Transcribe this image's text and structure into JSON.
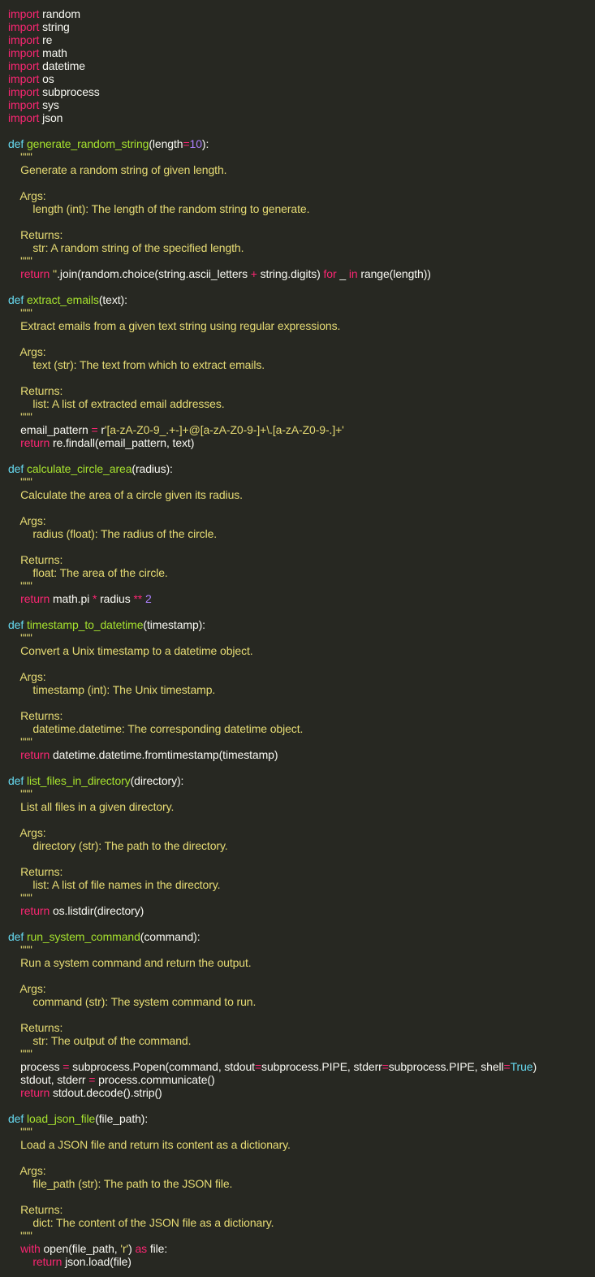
{
  "theme": {
    "background": "#272822",
    "keyword": "#f92672",
    "function_name": "#a6e22e",
    "def_keyword": "#66d9ef",
    "string": "#e6db74",
    "number": "#ae81ff",
    "plain": "#f8f8f2"
  },
  "lines": [
    [
      {
        "t": "kw",
        "v": "import"
      },
      {
        "t": "plain",
        "v": " random"
      }
    ],
    [
      {
        "t": "kw",
        "v": "import"
      },
      {
        "t": "plain",
        "v": " string"
      }
    ],
    [
      {
        "t": "kw",
        "v": "import"
      },
      {
        "t": "plain",
        "v": " re"
      }
    ],
    [
      {
        "t": "kw",
        "v": "import"
      },
      {
        "t": "plain",
        "v": " math"
      }
    ],
    [
      {
        "t": "kw",
        "v": "import"
      },
      {
        "t": "plain",
        "v": " datetime"
      }
    ],
    [
      {
        "t": "kw",
        "v": "import"
      },
      {
        "t": "plain",
        "v": " os"
      }
    ],
    [
      {
        "t": "kw",
        "v": "import"
      },
      {
        "t": "plain",
        "v": " subprocess"
      }
    ],
    [
      {
        "t": "kw",
        "v": "import"
      },
      {
        "t": "plain",
        "v": " sys"
      }
    ],
    [
      {
        "t": "kw",
        "v": "import"
      },
      {
        "t": "plain",
        "v": " json"
      }
    ],
    [],
    [
      {
        "t": "def",
        "v": "def"
      },
      {
        "t": "plain",
        "v": " "
      },
      {
        "t": "fn",
        "v": "generate_random_string"
      },
      {
        "t": "plain",
        "v": "(length"
      },
      {
        "t": "op",
        "v": "="
      },
      {
        "t": "num",
        "v": "10"
      },
      {
        "t": "plain",
        "v": "):"
      }
    ],
    [
      {
        "t": "doc",
        "v": "    \"\"\""
      }
    ],
    [
      {
        "t": "doc",
        "v": "    Generate a random string of given length."
      }
    ],
    [],
    [
      {
        "t": "doc",
        "v": "    Args:"
      }
    ],
    [
      {
        "t": "doc",
        "v": "        length (int): The length of the random string to generate."
      }
    ],
    [],
    [
      {
        "t": "doc",
        "v": "    Returns:"
      }
    ],
    [
      {
        "t": "doc",
        "v": "        str: A random string of the specified length."
      }
    ],
    [
      {
        "t": "doc",
        "v": "    \"\"\""
      }
    ],
    [
      {
        "t": "plain",
        "v": "    "
      },
      {
        "t": "kw",
        "v": "return"
      },
      {
        "t": "plain",
        "v": " "
      },
      {
        "t": "str",
        "v": "''"
      },
      {
        "t": "plain",
        "v": ".join(random.choice(string.ascii_letters "
      },
      {
        "t": "op",
        "v": "+"
      },
      {
        "t": "plain",
        "v": " string.digits) "
      },
      {
        "t": "kw",
        "v": "for"
      },
      {
        "t": "plain",
        "v": " _ "
      },
      {
        "t": "kw",
        "v": "in"
      },
      {
        "t": "plain",
        "v": " range(length))"
      }
    ],
    [],
    [
      {
        "t": "def",
        "v": "def"
      },
      {
        "t": "plain",
        "v": " "
      },
      {
        "t": "fn",
        "v": "extract_emails"
      },
      {
        "t": "plain",
        "v": "(text):"
      }
    ],
    [
      {
        "t": "doc",
        "v": "    \"\"\""
      }
    ],
    [
      {
        "t": "doc",
        "v": "    Extract emails from a given text string using regular expressions."
      }
    ],
    [],
    [
      {
        "t": "doc",
        "v": "    Args:"
      }
    ],
    [
      {
        "t": "doc",
        "v": "        text (str): The text from which to extract emails."
      }
    ],
    [],
    [
      {
        "t": "doc",
        "v": "    Returns:"
      }
    ],
    [
      {
        "t": "doc",
        "v": "        list: A list of extracted email addresses."
      }
    ],
    [
      {
        "t": "doc",
        "v": "    \"\"\""
      }
    ],
    [
      {
        "t": "plain",
        "v": "    email_pattern "
      },
      {
        "t": "op",
        "v": "="
      },
      {
        "t": "plain",
        "v": " r"
      },
      {
        "t": "str",
        "v": "'[a-zA-Z0-9_.+-]+@[a-zA-Z0-9-]+\\.[a-zA-Z0-9-.]+'"
      }
    ],
    [
      {
        "t": "plain",
        "v": "    "
      },
      {
        "t": "kw",
        "v": "return"
      },
      {
        "t": "plain",
        "v": " re.findall(email_pattern, text)"
      }
    ],
    [],
    [
      {
        "t": "def",
        "v": "def"
      },
      {
        "t": "plain",
        "v": " "
      },
      {
        "t": "fn",
        "v": "calculate_circle_area"
      },
      {
        "t": "plain",
        "v": "(radius):"
      }
    ],
    [
      {
        "t": "doc",
        "v": "    \"\"\""
      }
    ],
    [
      {
        "t": "doc",
        "v": "    Calculate the area of a circle given its radius."
      }
    ],
    [],
    [
      {
        "t": "doc",
        "v": "    Args:"
      }
    ],
    [
      {
        "t": "doc",
        "v": "        radius (float): The radius of the circle."
      }
    ],
    [],
    [
      {
        "t": "doc",
        "v": "    Returns:"
      }
    ],
    [
      {
        "t": "doc",
        "v": "        float: The area of the circle."
      }
    ],
    [
      {
        "t": "doc",
        "v": "    \"\"\""
      }
    ],
    [
      {
        "t": "plain",
        "v": "    "
      },
      {
        "t": "kw",
        "v": "return"
      },
      {
        "t": "plain",
        "v": " math.pi "
      },
      {
        "t": "op",
        "v": "*"
      },
      {
        "t": "plain",
        "v": " radius "
      },
      {
        "t": "op",
        "v": "**"
      },
      {
        "t": "plain",
        "v": " "
      },
      {
        "t": "num",
        "v": "2"
      }
    ],
    [],
    [
      {
        "t": "def",
        "v": "def"
      },
      {
        "t": "plain",
        "v": " "
      },
      {
        "t": "fn",
        "v": "timestamp_to_datetime"
      },
      {
        "t": "plain",
        "v": "(timestamp):"
      }
    ],
    [
      {
        "t": "doc",
        "v": "    \"\"\""
      }
    ],
    [
      {
        "t": "doc",
        "v": "    Convert a Unix timestamp to a datetime object."
      }
    ],
    [],
    [
      {
        "t": "doc",
        "v": "    Args:"
      }
    ],
    [
      {
        "t": "doc",
        "v": "        timestamp (int): The Unix timestamp."
      }
    ],
    [],
    [
      {
        "t": "doc",
        "v": "    Returns:"
      }
    ],
    [
      {
        "t": "doc",
        "v": "        datetime.datetime: The corresponding datetime object."
      }
    ],
    [
      {
        "t": "doc",
        "v": "    \"\"\""
      }
    ],
    [
      {
        "t": "plain",
        "v": "    "
      },
      {
        "t": "kw",
        "v": "return"
      },
      {
        "t": "plain",
        "v": " datetime.datetime.fromtimestamp(timestamp)"
      }
    ],
    [],
    [
      {
        "t": "def",
        "v": "def"
      },
      {
        "t": "plain",
        "v": " "
      },
      {
        "t": "fn",
        "v": "list_files_in_directory"
      },
      {
        "t": "plain",
        "v": "(directory):"
      }
    ],
    [
      {
        "t": "doc",
        "v": "    \"\"\""
      }
    ],
    [
      {
        "t": "doc",
        "v": "    List all files in a given directory."
      }
    ],
    [],
    [
      {
        "t": "doc",
        "v": "    Args:"
      }
    ],
    [
      {
        "t": "doc",
        "v": "        directory (str): The path to the directory."
      }
    ],
    [],
    [
      {
        "t": "doc",
        "v": "    Returns:"
      }
    ],
    [
      {
        "t": "doc",
        "v": "        list: A list of file names in the directory."
      }
    ],
    [
      {
        "t": "doc",
        "v": "    \"\"\""
      }
    ],
    [
      {
        "t": "plain",
        "v": "    "
      },
      {
        "t": "kw",
        "v": "return"
      },
      {
        "t": "plain",
        "v": " os.listdir(directory)"
      }
    ],
    [],
    [
      {
        "t": "def",
        "v": "def"
      },
      {
        "t": "plain",
        "v": " "
      },
      {
        "t": "fn",
        "v": "run_system_command"
      },
      {
        "t": "plain",
        "v": "(command):"
      }
    ],
    [
      {
        "t": "doc",
        "v": "    \"\"\""
      }
    ],
    [
      {
        "t": "doc",
        "v": "    Run a system command and return the output."
      }
    ],
    [],
    [
      {
        "t": "doc",
        "v": "    Args:"
      }
    ],
    [
      {
        "t": "doc",
        "v": "        command (str): The system command to run."
      }
    ],
    [],
    [
      {
        "t": "doc",
        "v": "    Returns:"
      }
    ],
    [
      {
        "t": "doc",
        "v": "        str: The output of the command."
      }
    ],
    [
      {
        "t": "doc",
        "v": "    \"\"\""
      }
    ],
    [
      {
        "t": "plain",
        "v": "    process "
      },
      {
        "t": "op",
        "v": "="
      },
      {
        "t": "plain",
        "v": " subprocess.Popen(command, stdout"
      },
      {
        "t": "op",
        "v": "="
      },
      {
        "t": "plain",
        "v": "subprocess.PIPE, stderr"
      },
      {
        "t": "op",
        "v": "="
      },
      {
        "t": "plain",
        "v": "subprocess.PIPE, shell"
      },
      {
        "t": "op",
        "v": "="
      },
      {
        "t": "builtin",
        "v": "True"
      },
      {
        "t": "plain",
        "v": ")"
      }
    ],
    [
      {
        "t": "plain",
        "v": "    stdout, stderr "
      },
      {
        "t": "op",
        "v": "="
      },
      {
        "t": "plain",
        "v": " process.communicate()"
      }
    ],
    [
      {
        "t": "plain",
        "v": "    "
      },
      {
        "t": "kw",
        "v": "return"
      },
      {
        "t": "plain",
        "v": " stdout.decode().strip()"
      }
    ],
    [],
    [
      {
        "t": "def",
        "v": "def"
      },
      {
        "t": "plain",
        "v": " "
      },
      {
        "t": "fn",
        "v": "load_json_file"
      },
      {
        "t": "plain",
        "v": "(file_path):"
      }
    ],
    [
      {
        "t": "doc",
        "v": "    \"\"\""
      }
    ],
    [
      {
        "t": "doc",
        "v": "    Load a JSON file and return its content as a dictionary."
      }
    ],
    [],
    [
      {
        "t": "doc",
        "v": "    Args:"
      }
    ],
    [
      {
        "t": "doc",
        "v": "        file_path (str): The path to the JSON file."
      }
    ],
    [],
    [
      {
        "t": "doc",
        "v": "    Returns:"
      }
    ],
    [
      {
        "t": "doc",
        "v": "        dict: The content of the JSON file as a dictionary."
      }
    ],
    [
      {
        "t": "doc",
        "v": "    \"\"\""
      }
    ],
    [
      {
        "t": "plain",
        "v": "    "
      },
      {
        "t": "kw",
        "v": "with"
      },
      {
        "t": "plain",
        "v": " open(file_path, "
      },
      {
        "t": "str",
        "v": "'r'"
      },
      {
        "t": "plain",
        "v": ") "
      },
      {
        "t": "kw",
        "v": "as"
      },
      {
        "t": "plain",
        "v": " file:"
      }
    ],
    [
      {
        "t": "plain",
        "v": "        "
      },
      {
        "t": "kw",
        "v": "return"
      },
      {
        "t": "plain",
        "v": " json.load(file)"
      }
    ]
  ]
}
